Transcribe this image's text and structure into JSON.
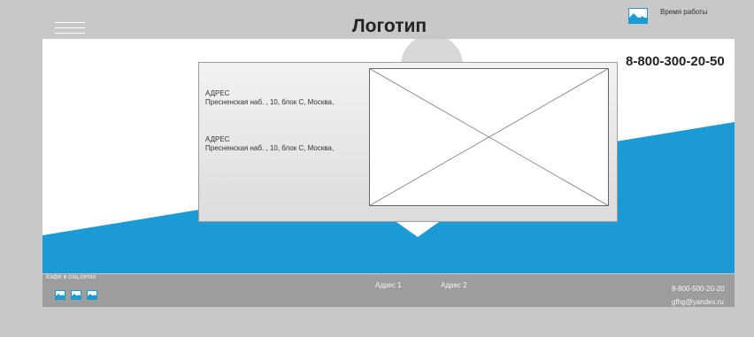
{
  "header": {
    "logo": "Логотип",
    "hours_label": "Время работы",
    "phone": "8-800-300-20-50"
  },
  "addresses": [
    {
      "title": "АДРЕС",
      "line": "Пресненская наб. , 10, блок С, Москва,"
    },
    {
      "title": "АДРЕС",
      "line": "Пресненская наб. , 10, блок С, Москва,"
    }
  ],
  "footer": {
    "social_title": "Кафе в соц.сетях",
    "links": [
      "Адрес 1",
      "Адрес 2"
    ],
    "phone": "8-800-500-20-20",
    "email": "gfhg@yandex.ru"
  },
  "colors": {
    "background": "#c8c8c8",
    "accent_blue": "#1b9ad6",
    "footer_bar": "#9d9d9d"
  },
  "icons": [
    "menu-icon",
    "image-icon",
    "map-placeholder-icon"
  ]
}
